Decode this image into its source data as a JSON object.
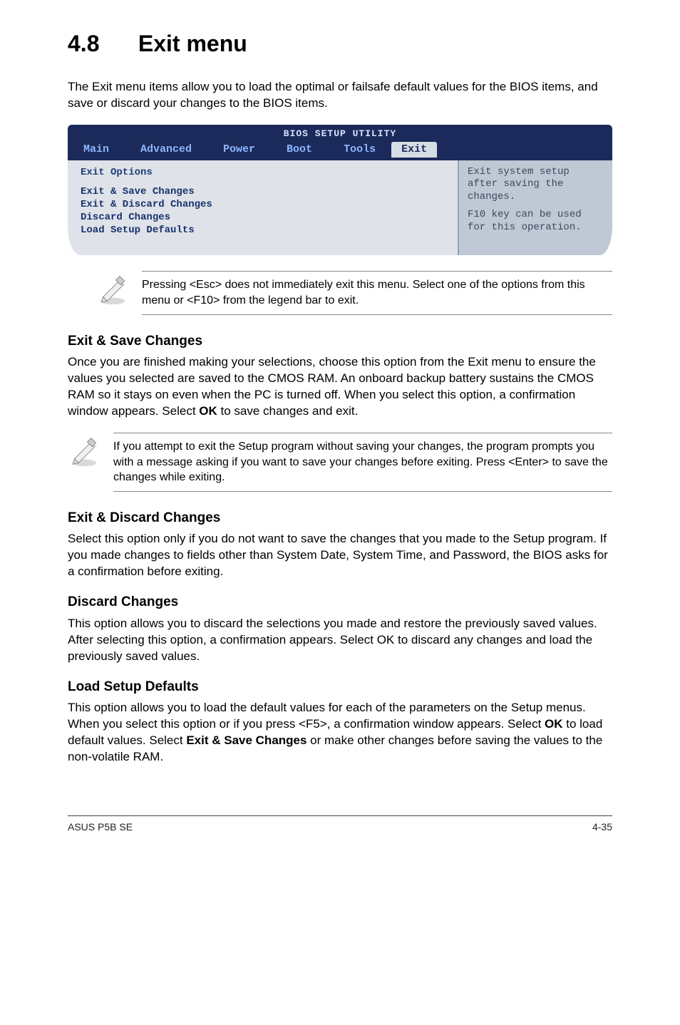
{
  "section": {
    "number": "4.8",
    "title": "Exit menu"
  },
  "intro": "The Exit menu items allow you to load the optimal or failsafe default values for the BIOS items, and save or discard your changes to the BIOS items.",
  "bios": {
    "utility_title": "BIOS SETUP UTILITY",
    "tabs": [
      "Main",
      "Advanced",
      "Power",
      "Boot",
      "Tools",
      "Exit"
    ],
    "left": {
      "heading": "Exit Options",
      "lines": [
        "Exit & Save Changes",
        "Exit & Discard Changes",
        "Discard Changes",
        "",
        "Load Setup Defaults"
      ]
    },
    "right": {
      "p1": "Exit system setup after saving the changes.",
      "p2": "F10 key can be used for this operation."
    }
  },
  "note1": "Pressing <Esc> does not immediately exit this menu. Select one of the options from this menu or <F10> from the legend bar to exit.",
  "sub1": {
    "title": "Exit & Save Changes",
    "body_a": "Once you are finished making your selections, choose this option from the Exit menu to ensure the values you selected are saved to the CMOS RAM. An onboard backup battery sustains the CMOS RAM so it stays on even when the PC is turned off. When you select this option, a confirmation window appears. Select ",
    "body_ok": "OK",
    "body_b": " to save changes and exit."
  },
  "note2": " If you attempt to exit the Setup program without saving your changes, the program prompts you with a message asking if you want to save your changes before exiting. Press <Enter>  to save the  changes while exiting.",
  "sub2": {
    "title": "Exit & Discard Changes",
    "body": "Select this option only if you do not want to save the changes that you  made to the Setup program. If you made changes to fields other than System Date, System Time, and Password, the BIOS asks for a confirmation before exiting."
  },
  "sub3": {
    "title": "Discard Changes",
    "body_a": "This option allows you to discard the selections you made and restore the previously saved values. After selecting this option, a confirmation appears. Select ",
    "body_ok": "OK",
    "body_b": " to discard any changes and load the previously saved values."
  },
  "sub4": {
    "title": "Load Setup Defaults",
    "body_a": "This option allows you to load the default values for each of the parameters on the Setup menus. When you select this option or if you press <F5>, a confirmation window appears. Select ",
    "body_ok": "OK",
    "body_b": " to load default values. Select ",
    "body_bold": "Exit & Save Changes",
    "body_c": " or make other changes before saving the values to the non-volatile RAM."
  },
  "footer": {
    "left": "ASUS P5B SE",
    "right": "4-35"
  }
}
